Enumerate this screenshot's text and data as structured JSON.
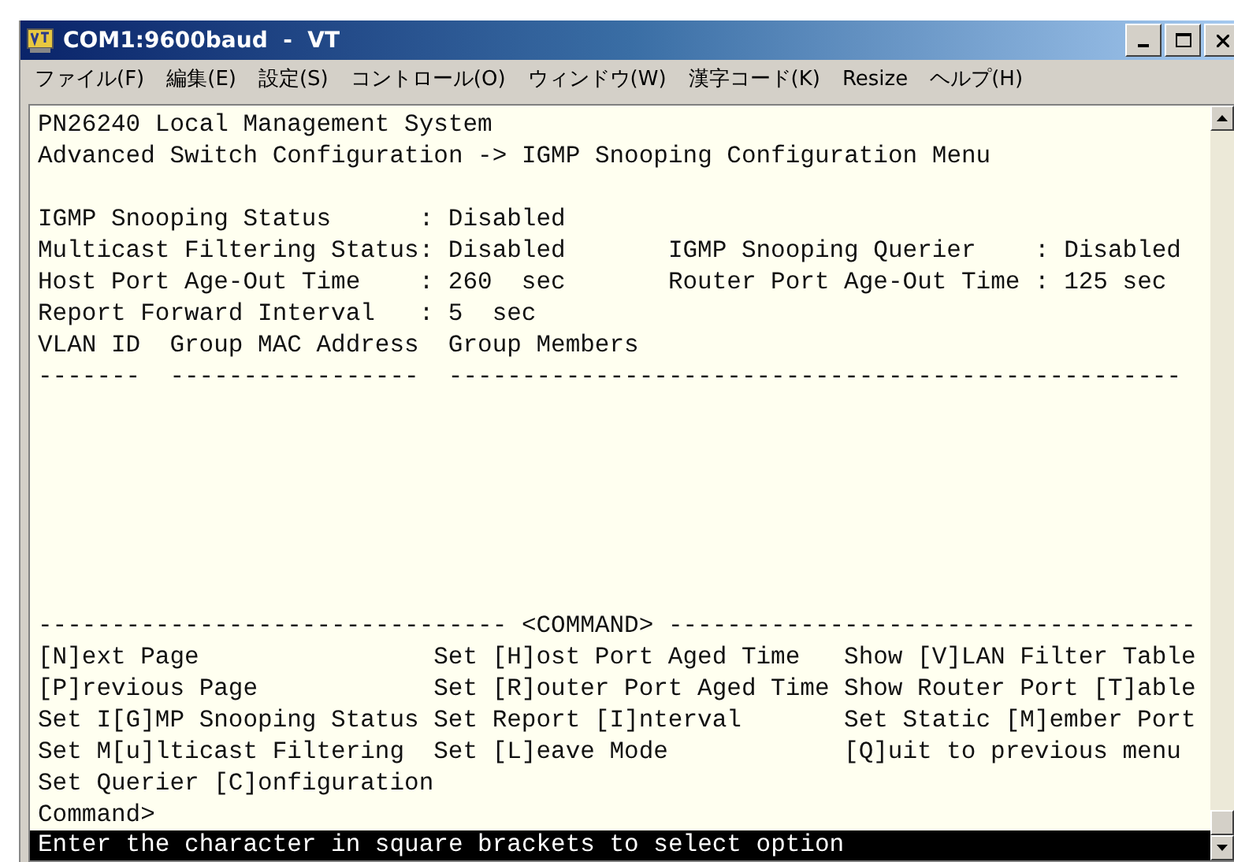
{
  "window": {
    "title": "COM1:9600baud  -  VT"
  },
  "menu": [
    "ファイル(F)",
    "編集(E)",
    "設定(S)",
    "コントロール(O)",
    "ウィンドウ(W)",
    "漢字コード(K)",
    "Resize",
    "ヘルプ(H)"
  ],
  "terminal": {
    "header": [
      "PN26240 Local Management System",
      "Advanced Switch Configuration -> IGMP Snooping Configuration Menu"
    ],
    "status": [
      {
        "left": {
          "label": "IGMP Snooping Status",
          "sep": ":",
          "value": "Disabled"
        }
      },
      {
        "left": {
          "label": "Multicast Filtering Status",
          "sep": ":",
          "value": "Disabled"
        },
        "right": {
          "label": "IGMP Snooping Querier",
          "sep": ":",
          "value": "Disabled"
        }
      },
      {
        "left": {
          "label": "Host Port Age-Out Time",
          "sep": ":",
          "value": "260  sec"
        },
        "right": {
          "label": "Router Port Age-Out Time",
          "sep": ":",
          "value": "125 sec"
        }
      },
      {
        "left": {
          "label": "Report Forward Interval",
          "sep": ":",
          "value": "5  sec"
        }
      }
    ],
    "table": {
      "columns": [
        "VLAN ID",
        "Group MAC Address",
        "Group Members"
      ],
      "rules": [
        "-------",
        "-----------------",
        "--------------------------------------------------"
      ]
    },
    "command": {
      "rule_left": "--------------------------------",
      "title": "<COMMAND>",
      "rule_right": "------------------------------------",
      "options": [
        [
          "[N]ext Page",
          "Set [H]ost Port Aged Time",
          "Show [V]LAN Filter Table"
        ],
        [
          "[P]revious Page",
          "Set [R]outer Port Aged Time",
          "Show Router Port [T]able"
        ],
        [
          "Set I[G]MP Snooping Status",
          "Set Report [I]nterval",
          "Set Static [M]ember Port"
        ],
        [
          "Set M[u]lticast Filtering",
          "Set [L]eave Mode",
          "[Q]uit to previous menu"
        ],
        [
          "Set Querier [C]onfiguration"
        ]
      ],
      "prompt": "Command>"
    },
    "status_line": "Enter the character in square brackets to select option"
  }
}
